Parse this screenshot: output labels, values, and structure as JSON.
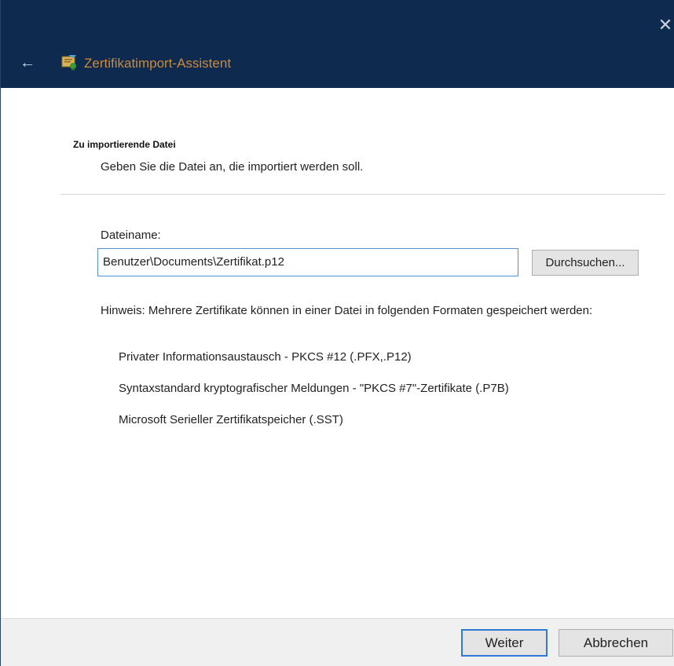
{
  "window": {
    "title": "Zertifikatimport-Assistent",
    "close_glyph": "✕",
    "back_glyph": "←",
    "titlebar_color": "#0e2a4f",
    "title_color": "#cc8a3a",
    "icon": "certificate-icon"
  },
  "page": {
    "section_title": "Zu importierende Datei",
    "section_subtitle": "Geben Sie die Datei an, die importiert werden soll.",
    "filename_label": "Dateiname:",
    "filename_value": "Benutzer\\Documents\\Zertifikat.p12",
    "browse_label": "Durchsuchen...",
    "hint": "Hinweis: Mehrere Zertifikate können in einer Datei in folgenden Formaten gespeichert werden:",
    "formats": [
      "Privater Informationsaustausch - PKCS #12 (.PFX,.P12)",
      "Syntaxstandard kryptografischer Meldungen - \"PKCS #7\"-Zertifikate (.P7B)",
      "Microsoft Serieller Zertifikatspeicher (.SST)"
    ]
  },
  "footer": {
    "next_label": "Weiter",
    "cancel_label": "Abbrechen",
    "accent": "#2f7ad6"
  }
}
